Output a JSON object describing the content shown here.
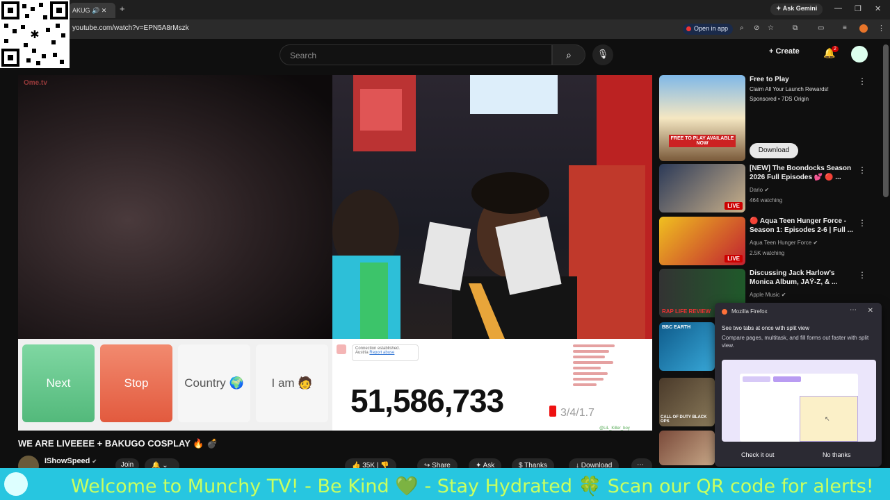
{
  "browser": {
    "tab_title": "AKUG",
    "url": "youtube.com/watch?v=EPN5A8rMszk",
    "open_in_app": "Open in app",
    "ask_gemini": "Ask Gemini"
  },
  "youtube": {
    "search_placeholder": "Search",
    "create_label": "Create",
    "notification_count": "2"
  },
  "video": {
    "ometv_logo": "Ome.tv",
    "buttons": {
      "next": "Next",
      "stop": "Stop",
      "country": "Country 🌍",
      "i_am": "I am 🧑"
    },
    "connection_text": "Connection established.",
    "connection_sub": "Austria",
    "report_abuse": "Report abuse",
    "counter": "51,586,733",
    "overlay_small": "3/4/1.7",
    "handle": "@LiL_Killer_boy"
  },
  "below_video": {
    "title": "WE ARE LIVEEEE + BAKUGO COSPLAY 🔥 💣",
    "channel": "IShowSpeed",
    "join": "Join",
    "likes": "35K",
    "share": "Share",
    "ask": "Ask",
    "thanks": "Thanks",
    "download": "Download"
  },
  "sidebar": [
    {
      "title": "Free to Play",
      "line2": "Claim All Your Launch Rewards!",
      "line3": "Sponsored • 7DS Origin",
      "button": "Download",
      "thumb_text": "FREE TO PLAY AVAILABLE NOW",
      "live": ""
    },
    {
      "title": "[NEW] The Boondocks Season 2026 Full Episodes 💕 🔴 ...",
      "line2": "Dario ✔",
      "line3": "464 watching",
      "live": "LIVE"
    },
    {
      "title": "🔴 Aqua Teen Hunger Force - Season 1: Episodes 2-6 | Full ...",
      "line2": "Aqua Teen Hunger Force ✔",
      "line3": "2.5K watching",
      "live": "LIVE"
    },
    {
      "title": "Discussing Jack Harlow's Monica Album, JAŸ-Z, & ...",
      "line2": "Apple Music ✔",
      "line3": "",
      "thumb_text": "RAP LIFE REVIEW",
      "live": ""
    },
    {
      "title": "",
      "line2": "",
      "line3": "",
      "thumb_text": "BBC EARTH",
      "live": ""
    },
    {
      "title": "",
      "line2": "",
      "line3": "",
      "thumb_text": "CALL OF DUTY BLACK OPS",
      "live": ""
    },
    {
      "title": "",
      "line2": "",
      "line3": "",
      "live": ""
    }
  ],
  "firefox_popup": {
    "app": "Mozilla Firefox",
    "title": "See two tabs at once with split view",
    "body": "Compare pages, multitask, and fill forms out faster with split view.",
    "check_it_out": "Check it out",
    "no_thanks": "No thanks"
  },
  "ticker": {
    "text": "Welcome to Munchy TV!  - Be Kind 💚  - Stay Hydrated 🍀  Scan our QR code for alerts!"
  },
  "colors": {
    "ticker_bg": "#27c6e0",
    "ticker_text": "#c8ff60",
    "next_btn": "#53b97b",
    "stop_btn": "#e25a3e",
    "live_red": "#cc0000"
  }
}
